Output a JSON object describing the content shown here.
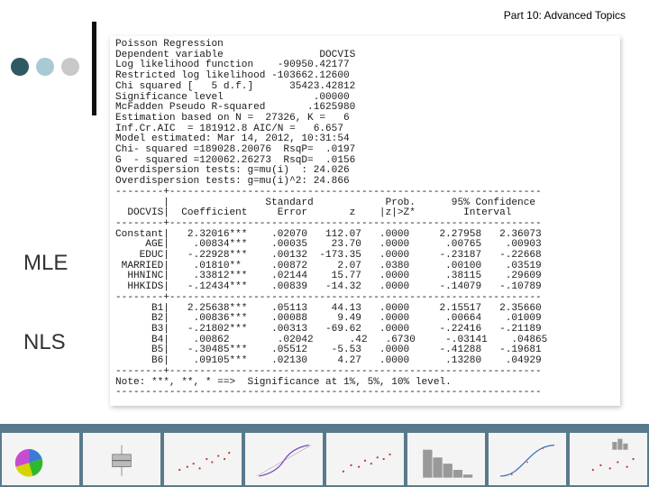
{
  "header": {
    "title": "Part 10: Advanced Topics"
  },
  "decor": {
    "dot_colors": [
      "#2f5963",
      "#a9c9d4",
      "#c8c8c8"
    ],
    "accent_bar_color": "#111111",
    "footer_bg": "#5a7a8c"
  },
  "labels": {
    "mle": "MLE",
    "nls": "NLS"
  },
  "output": {
    "lines": [
      "Poisson Regression",
      "Dependent variable                DOCVIS",
      "Log likelihood function    -90950.42177",
      "Restricted log likelihood -103662.12600",
      "Chi squared [   5 d.f.]      35423.42812",
      "Significance level               .00000",
      "McFadden Pseudo R-squared       .1625980",
      "Estimation based on N =  27326, K =   6",
      "Inf.Cr.AIC  = 181912.8 AIC/N =   6.657",
      "Model estimated: Mar 14, 2012, 10:31:54",
      "Chi- squared =189028.20076  RsqP=  .0197",
      "G  - squared =120062.26273  RsqD=  .0156",
      "Overdispersion tests: g=mu(i)  : 24.026",
      "Overdispersion tests: g=mu(i)^2: 24.866",
      "--------+--------------------------------------------------------------",
      "        |                Standard            Prob.      95% Confidence",
      "  DOCVIS|  Coefficient     Error       z    |z|>Z*        Interval",
      "--------+--------------------------------------------------------------",
      "Constant|   2.32016***    .02070   112.07   .0000     2.27958   2.36073",
      "     AGE|    .00834***    .00035    23.70   .0000      .00765    .00903",
      "    EDUC|   -.22928***    .00132  -173.35   .0000     -.23187   -.22668",
      " MARRIED|    .01810**     .00872     2.07   .0380      .00100    .03519",
      "  HHNINC|    .33812***    .02144    15.77   .0000      .38115    .29609",
      "  HHKIDS|   -.12434***    .00839   -14.32   .0000     -.14079   -.10789",
      "--------+--------------------------------------------------------------",
      "      B1|   2.25638***    .05113    44.13   .0000     2.15517   2.35660",
      "      B2|    .00836***    .00088     9.49   .0000      .00664    .01009",
      "      B3|   -.21802***    .00313   -69.62   .0000     -.22416   -.21189",
      "      B4|    .00862        .02042      .42   .6730     -.03141    .04865",
      "      B5|   -.30485***    .05512    -5.53   .0000     -.41288   -.19681",
      "      B6|    .09105***    .02130     4.27   .0000      .13280    .04929",
      "--------+--------------------------------------------------------------",
      "Note: ***, **, * ==>  Significance at 1%, 5%, 10% level.",
      "-----------------------------------------------------------------------"
    ]
  }
}
